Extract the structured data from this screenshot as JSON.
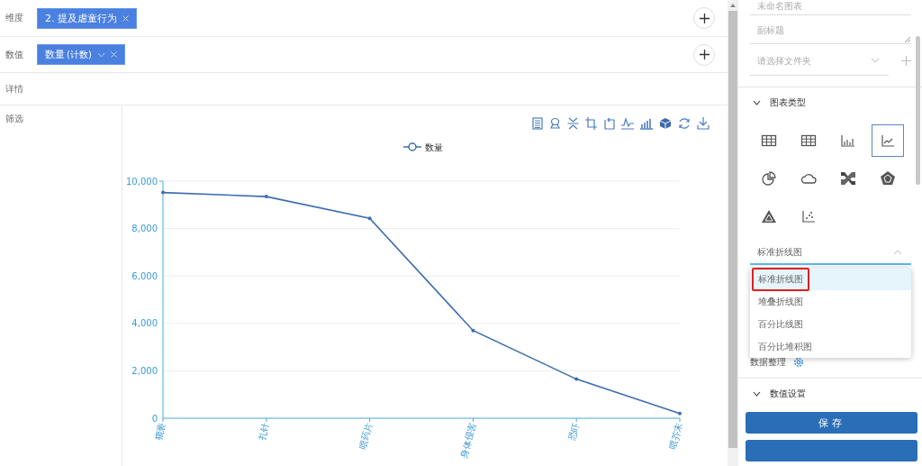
{
  "rows": [
    {
      "label": "维度",
      "addable": true,
      "tags": [
        {
          "text": "2. 提及虐童行为",
          "has_menu": false
        }
      ]
    },
    {
      "label": "数值",
      "addable": true,
      "tags": [
        {
          "text": "数量",
          "note": "(计数)",
          "has_menu": true
        }
      ]
    },
    {
      "label": "详情",
      "addable": false,
      "tags": []
    },
    {
      "label": "筛选",
      "addable": false,
      "tags": []
    }
  ],
  "chart": {
    "chart_data": {
      "type": "line",
      "categories": [
        "猥亵",
        "扎针",
        "喂药片",
        "身体侵害",
        "恐吓",
        "喂芥末"
      ],
      "series": [
        {
          "name": "数量",
          "color": "#3c6db0",
          "values": [
            9520,
            9350,
            8430,
            3700,
            1650,
            200
          ]
        }
      ],
      "ylim": [
        0,
        10000
      ],
      "grid": true,
      "yticks": [
        {
          "value": 0,
          "label": "0"
        },
        {
          "value": 2000,
          "label": "2,000"
        },
        {
          "value": 4000,
          "label": "4,000"
        },
        {
          "value": 6000,
          "label": "6,000"
        },
        {
          "value": 8000,
          "label": "8,000"
        },
        {
          "value": 10000,
          "label": "10,000"
        }
      ]
    }
  },
  "panel": {
    "title_placeholder": "未命名图表",
    "subtitle_placeholder": "副标题",
    "folder_placeholder": "请选择文件夹",
    "chart_type_section": {
      "title": "图表类型",
      "expanded": true,
      "types": [
        {
          "kind": "table",
          "selected": false
        },
        {
          "kind": "table",
          "selected": false
        },
        {
          "kind": "bar",
          "selected": false
        },
        {
          "kind": "line",
          "selected": true
        },
        {
          "kind": "pie",
          "selected": false
        },
        {
          "kind": "cloud",
          "selected": false
        },
        {
          "kind": "sankey",
          "selected": false
        },
        {
          "kind": "radar",
          "selected": false
        },
        {
          "kind": "triangle",
          "selected": false
        },
        {
          "kind": "scatter",
          "selected": false
        }
      ],
      "subtype_select": {
        "value": "标准折线图",
        "open": true,
        "options": [
          {
            "label": "标准折线图",
            "selected": true
          },
          {
            "label": "堆叠折线图",
            "selected": false
          },
          {
            "label": "百分比线图",
            "selected": false
          },
          {
            "label": "百分比堆积图",
            "selected": false
          }
        ]
      }
    },
    "data_arrange": {
      "label": "数据整理"
    },
    "value_section": {
      "title": "数值设置",
      "expanded": true
    },
    "buttons": [
      "保存"
    ]
  }
}
